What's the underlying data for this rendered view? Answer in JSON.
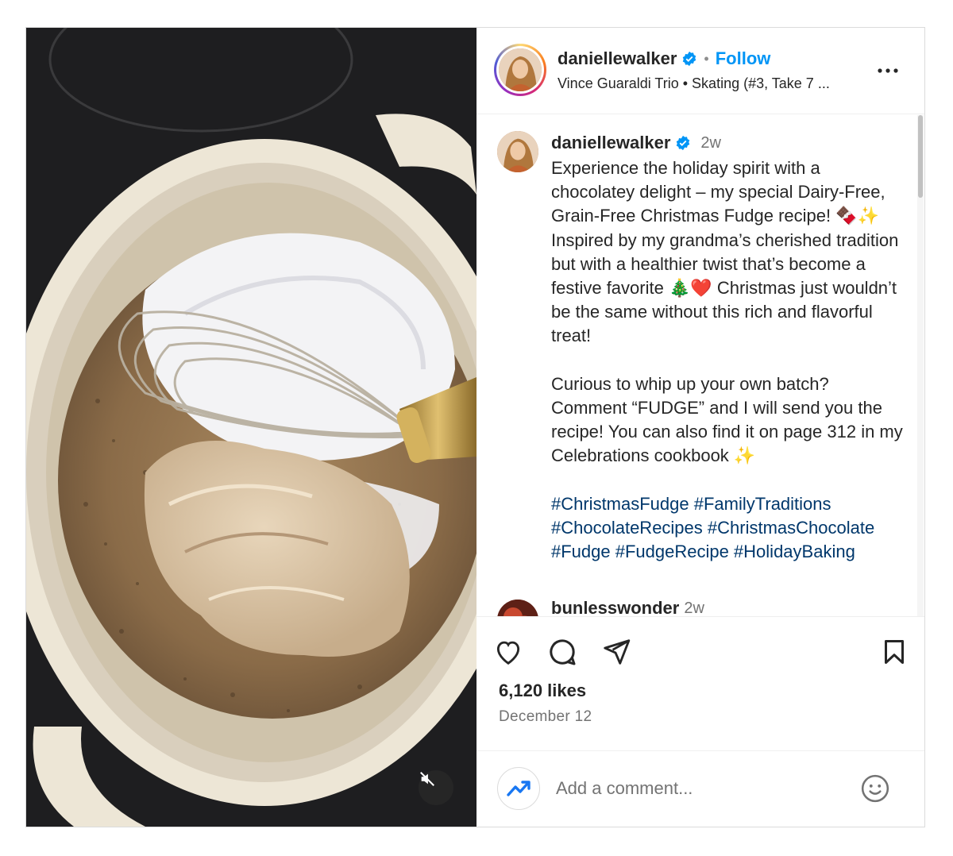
{
  "post": {
    "username": "daniellewalker",
    "follow_label": "Follow",
    "audio": "Vince Guaraldi Trio • Skating (#3, Take 7 ...",
    "caption_time": "2w",
    "caption": [
      "Experience the holiday spirit with a chocolatey delight – my special Dairy-Free, Grain-Free Christmas Fudge recipe! 🍫✨ Inspired by my grandma’s cherished tradition but with a healthier twist that’s become a festive favorite 🎄❤️ Christmas just wouldn’t be the same without this rich and flavorful treat!",
      "Curious to whip up your own batch? Comment “FUDGE” and I will send you the recipe! You can also find it on page 312 in my Celebrations cookbook ✨"
    ],
    "hashtags": "#ChristmasFudge #FamilyTraditions #ChocolateRecipes #ChristmasChocolate #Fudge #FudgeRecipe #HolidayBaking",
    "likes": "6,120 likes",
    "date": "December 12"
  },
  "comments": [
    {
      "username": "bunlesswonder",
      "time": "2w"
    }
  ],
  "comment_box": {
    "placeholder": "Add a comment..."
  },
  "icons": {
    "verified": "verified-badge-icon",
    "more": "more-options-icon",
    "like": "heart-icon",
    "comment": "comment-bubble-icon",
    "share": "paper-plane-icon",
    "save": "bookmark-icon",
    "mute": "speaker-muted-icon",
    "emoji": "smiley-icon",
    "viewer_avatar": "trend-arrow-icon"
  },
  "colors": {
    "accent": "#0095f6",
    "hashtag": "#00376b",
    "verified": "#0095f6",
    "secondary_text": "#737373"
  }
}
